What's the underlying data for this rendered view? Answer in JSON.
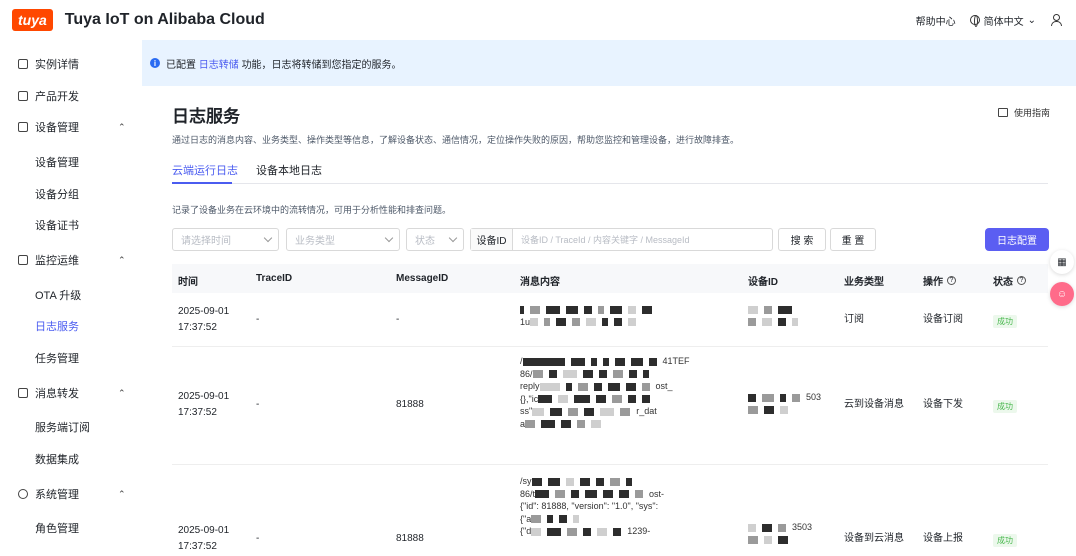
{
  "header": {
    "logo": "tuya",
    "title": "Tuya IoT on Alibaba Cloud",
    "help": "帮助中心",
    "language": "简体中文"
  },
  "sidebar": {
    "items": [
      {
        "label": "实例详情",
        "icon": "home-icon"
      },
      {
        "label": "产品开发",
        "icon": "screen-icon"
      },
      {
        "label": "设备管理",
        "icon": "device-icon",
        "expanded": true
      },
      {
        "label": "设备管理",
        "sub": true
      },
      {
        "label": "设备分组",
        "sub": true
      },
      {
        "label": "设备证书",
        "sub": true
      },
      {
        "label": "监控运维",
        "icon": "monitor-icon",
        "expanded": true
      },
      {
        "label": "OTA 升级",
        "sub": true
      },
      {
        "label": "日志服务",
        "sub": true,
        "active": true
      },
      {
        "label": "任务管理",
        "sub": true
      },
      {
        "label": "消息转发",
        "icon": "forward-icon",
        "expanded": true
      },
      {
        "label": "服务端订阅",
        "sub": true
      },
      {
        "label": "数据集成",
        "sub": true
      },
      {
        "label": "系统管理",
        "icon": "gear-icon",
        "expanded": true
      },
      {
        "label": "角色管理",
        "sub": true
      }
    ]
  },
  "notice": {
    "prefix": "已配置",
    "link": "日志转储",
    "suffix": "功能，日志将转储到您指定的服务。"
  },
  "page": {
    "title": "日志服务",
    "guide": "使用指南",
    "description": "通过日志的消息内容、业务类型、操作类型等信息，了解设备状态、通信情况，定位操作失败的原因，帮助您监控和管理设备，进行故障排查。",
    "tabs": [
      "云端运行日志",
      "设备本地日志"
    ],
    "subdescription": "记录了设备业务在云环境中的流转情况，可用于分析性能和排查问题。"
  },
  "filters": {
    "time_placeholder": "请选择时间",
    "biz_placeholder": "业务类型",
    "status_placeholder": "状态",
    "id_label": "设备ID",
    "id_placeholder": "设备ID / TraceId / 内容关键字 / MessageId",
    "search": "搜 索",
    "reset": "重 置",
    "config": "日志配置"
  },
  "table": {
    "columns": [
      "时间",
      "TraceID",
      "MessageID",
      "消息内容",
      "设备ID",
      "业务类型",
      "操作",
      "状态"
    ],
    "rows": [
      {
        "date": "2025-09-01",
        "time": "17:37:52",
        "trace": "-",
        "msgid": "-",
        "lines": [
          "",
          "1u"
        ],
        "device": "",
        "biz": "订阅",
        "op": "设备订阅",
        "status": "成功"
      },
      {
        "date": "2025-09-01",
        "time": "17:37:52",
        "trace": "-",
        "msgid": "81888",
        "lines": [
          "/",
          "86/",
          "reply",
          "{},\"ic",
          "ss\"",
          "a"
        ],
        "line_ends": [
          "41TEF",
          "",
          "ost_",
          "",
          "r_dat",
          ""
        ],
        "device": "503",
        "biz": "云到设备消息",
        "op": "设备下发",
        "status": "成功"
      },
      {
        "date": "2025-09-01",
        "time": "17:37:52",
        "trace": "-",
        "msgid": "81888",
        "lines": [
          "/sy",
          "86/t",
          "{\"id\": 81888, \"version\": \"1.0\", \"sys\":",
          "{\"a",
          "{\"d"
        ],
        "line_ends": [
          "",
          "ost-",
          "",
          "",
          "1239-"
        ],
        "device": "3503",
        "biz": "设备到云消息",
        "op": "设备上报",
        "status": "成功"
      }
    ]
  }
}
